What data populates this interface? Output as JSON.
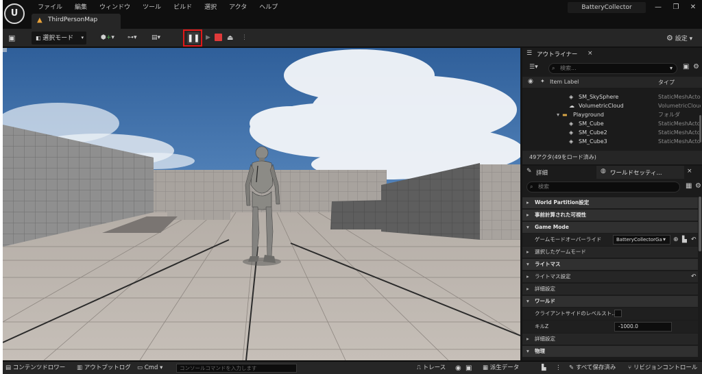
{
  "menu": [
    "ファイル",
    "編集",
    "ウィンドウ",
    "ツール",
    "ビルド",
    "選択",
    "アクタ",
    "ヘルプ"
  ],
  "project_name": "BatteryCollector",
  "document_tab": "ThirdPersonMap",
  "toolbar": {
    "select_mode": "選択モード",
    "settings": "設定"
  },
  "outliner": {
    "tab_title": "アウトライナー",
    "search_placeholder": "検索...",
    "column_label": "Item Label",
    "column_type": "タイプ",
    "rows": [
      {
        "label": "SM_SkySphere",
        "type": "StaticMeshActor"
      },
      {
        "label": "VolumetricCloud",
        "type": "VolumetricCloud"
      },
      {
        "label": "Playground",
        "type": "フォルダ"
      },
      {
        "label": "SM_Cube",
        "type": "StaticMeshActor"
      },
      {
        "label": "SM_Cube2",
        "type": "StaticMeshActor"
      },
      {
        "label": "SM_Cube3",
        "type": "StaticMeshActor"
      }
    ],
    "actor_count": "49アクタ(49をロード済み)"
  },
  "details": {
    "tab_details": "詳細",
    "tab_world_settings": "ワールドセッティ...",
    "search_placeholder": "検索",
    "world_partition": "World Partition設定",
    "precomputed_visibility": "事前計算された可視性",
    "game_mode": "Game Mode",
    "gamemode_override_label": "ゲームモードオーバーライド",
    "gamemode_override_value": "BatteryCollectorGa",
    "selected_gamemode": "選択したゲームモード",
    "lightmass": "ライトマス",
    "lightmass_settings": "ライトマス設定",
    "advanced": "詳細設定",
    "world": "ワールド",
    "client_side_label": "クライアントサイドのレベルスト...",
    "kill_z_label": "キルZ",
    "kill_z_value": "-1000.0",
    "advanced2": "詳細設定",
    "physics": "物理"
  },
  "statusbar": {
    "content_drawer": "コンテンツドロワー",
    "output_log": "アウトプットログ",
    "cmd": "Cmd",
    "console_placeholder": "コンソールコマンドを入力します",
    "trace": "トレース",
    "derived_data": "派生データ",
    "all_saved": "すべて保存済み",
    "revision_control": "リビジョンコントロール"
  },
  "colors": {
    "pause_highlight": "#e21818",
    "stop": "#e03a3a",
    "folder": "#d9a546"
  }
}
